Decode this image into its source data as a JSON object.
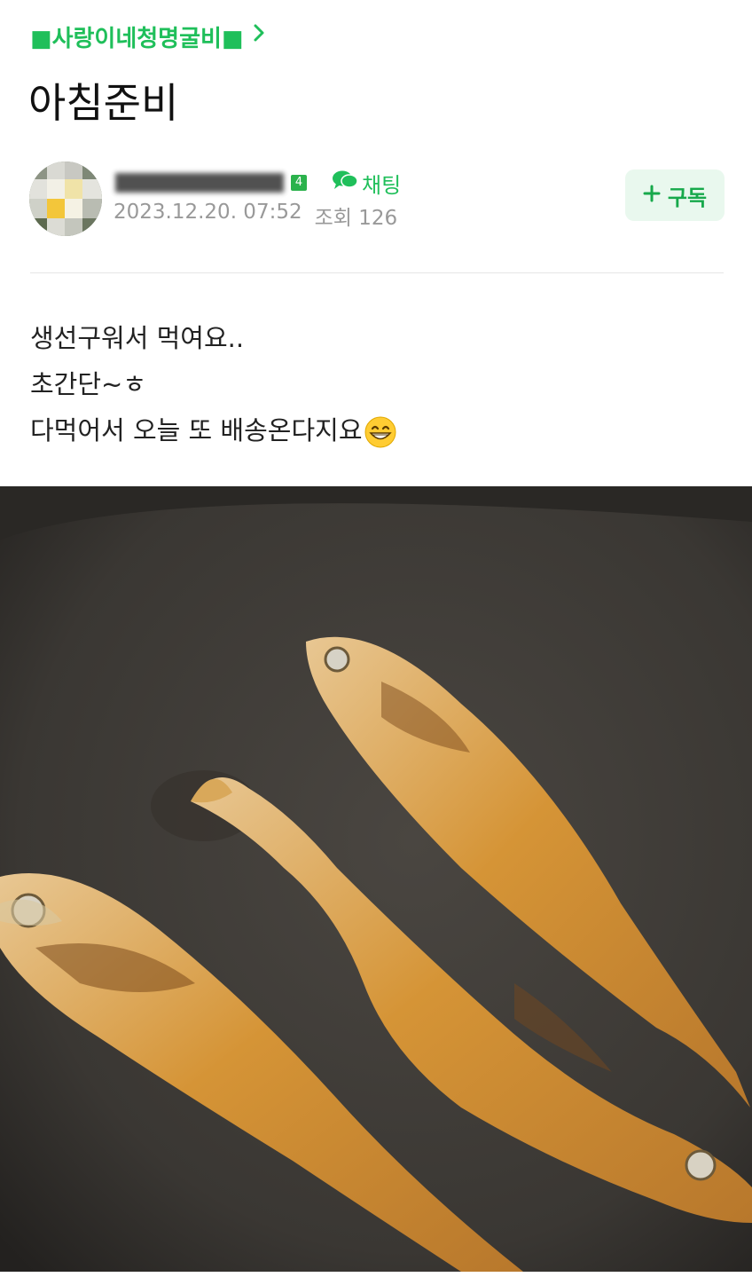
{
  "header": {
    "cafe_name": "■사랑이네청명굴비■",
    "chevron_icon": "chevron-right-icon"
  },
  "post": {
    "title": "아침준비",
    "author": {
      "name": "******** ****",
      "grade_badge": "4",
      "avatar_icon": "avatar-flower-blurred"
    },
    "chat_label": "채팅",
    "date": "2023.12.20. 07:52",
    "views_label": "조회 126",
    "subscribe_label": "구독",
    "subscribe_icon": "plus-icon",
    "body_lines": [
      "생선구워서 먹여요..",
      "초간단~ㅎ",
      "다먹어서 오늘 또 배송온다지요"
    ],
    "emoji": "grinning-face-icon",
    "photo": "fried-yellow-croakers-in-pan"
  },
  "colors": {
    "accent_green": "#1fbf5a",
    "subscribe_bg": "#e9f8ee",
    "meta_gray": "#999999"
  }
}
